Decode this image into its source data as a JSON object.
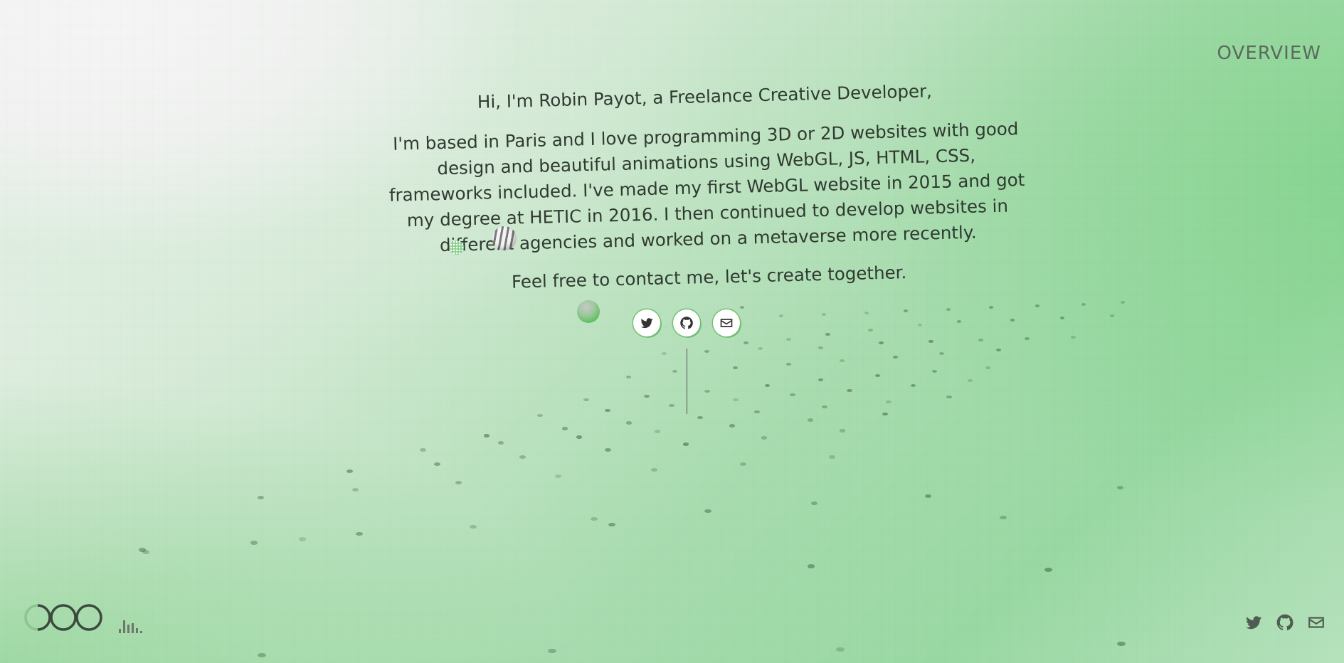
{
  "nav": {
    "overview_label": "OVERVIEW"
  },
  "intro": {
    "greeting": "Hi, I'm Robin Payot, a Freelance Creative Developer,",
    "bio": "I'm based in Paris and I love programming 3D or 2D websites with good design and beautiful animations using WebGL, JS, HTML, CSS, frameworks included. I've made my first WebGL website in 2015 and got my degree at HETIC in 2016. I then continued to develop websites in different agencies and worked on a metaverse more recently.",
    "cta": "Feel free to contact me, let's create together."
  },
  "social": [
    {
      "icon": "twitter-icon"
    },
    {
      "icon": "github-icon"
    },
    {
      "icon": "mail-icon"
    }
  ],
  "footer": {
    "logo_icon": "three-circles-logo-icon",
    "audio_icon": "sound-bars-icon",
    "social_icons": [
      "twitter-icon",
      "github-icon",
      "mail-icon"
    ]
  },
  "colors": {
    "accent_green": "#5fbf5f",
    "text": "#2f3a30",
    "muted": "#5a6a5c"
  }
}
